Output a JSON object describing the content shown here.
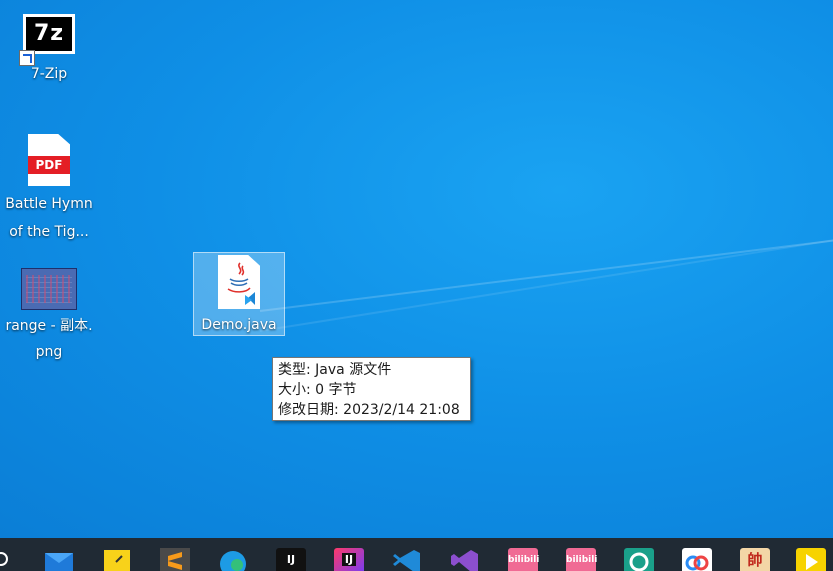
{
  "desktop": {
    "icons": [
      {
        "label": "7-Zip",
        "logo_text": "7z"
      },
      {
        "label_line1": "Battle Hymn",
        "label_line2": "of the Tig...",
        "badge": "PDF"
      },
      {
        "label_line1": "range - 副本.",
        "label_line2": "png"
      },
      {
        "label": "Demo.java"
      }
    ]
  },
  "tooltip": {
    "type": "类型: Java 源文件",
    "size": "大小: 0 字节",
    "modified": "修改日期: 2023/2/14 21:08"
  },
  "taskbar": {
    "apps": [
      {
        "icon": "mail-icon"
      },
      {
        "icon": "sticky-notes-icon"
      },
      {
        "icon": "sublime-text-icon"
      },
      {
        "icon": "edge-icon"
      },
      {
        "icon": "intellij-idea-icon",
        "text": "IJ"
      },
      {
        "icon": "intellij-idea-icon-2",
        "text": "IJ"
      },
      {
        "icon": "vscode-icon"
      },
      {
        "icon": "visual-studio-icon"
      },
      {
        "icon": "bilibili-icon",
        "text": "bilibili"
      },
      {
        "icon": "bilibili-icon-2",
        "text": "bilibili"
      },
      {
        "icon": "green-app-icon"
      },
      {
        "icon": "baidu-netdisk-icon"
      },
      {
        "icon": "chess-icon",
        "text": "帥"
      },
      {
        "icon": "player-icon"
      }
    ],
    "colors": {
      "bar": "#202a34",
      "desktop": "#0f8fe6",
      "pdf_red": "#e41e25"
    }
  }
}
